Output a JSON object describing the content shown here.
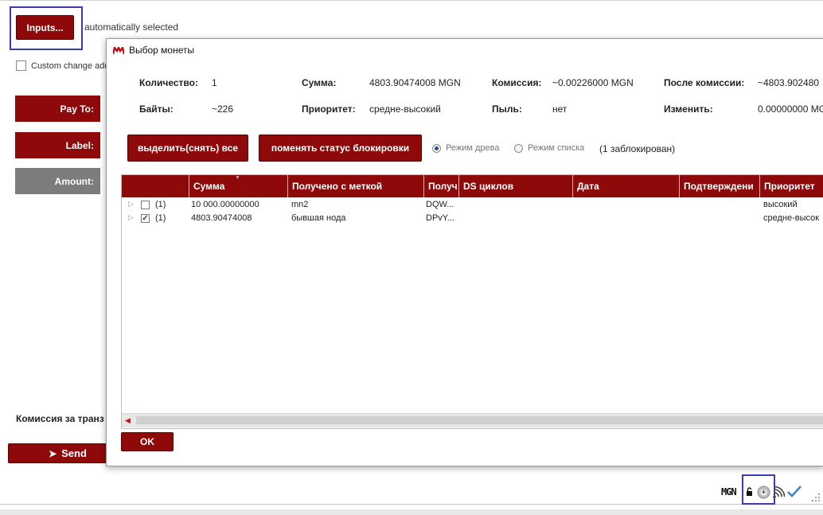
{
  "main": {
    "inputs_button": "Inputs...",
    "auto_selected": "automatically selected",
    "custom_change": "Custom change add",
    "pay_to_label": "Pay To:",
    "label_label": "Label:",
    "amount_label": "Amount:",
    "fee_label": "Комиссия за транз",
    "send_button": "Send"
  },
  "dialog": {
    "title": "Выбор монеты",
    "info": {
      "quantity_label": "Количество:",
      "quantity_value": "1",
      "sum_label": "Сумма:",
      "sum_value": "4803.90474008 MGN",
      "fee_label": "Комиссия:",
      "fee_value": "~0.00226000 MGN",
      "after_fee_label": "После комиссии:",
      "after_fee_value": "~4803.902480",
      "bytes_label": "Байты:",
      "bytes_value": "~226",
      "priority_label": "Приоритет:",
      "priority_value": "средне-высокий",
      "dust_label": "Пыль:",
      "dust_value": "нет",
      "change_label": "Изменить:",
      "change_value": "0.00000000 MG"
    },
    "select_all_button": "выделить(снять) все",
    "toggle_lock_button": "поменять статус блокировки",
    "tree_mode": "Режим древа",
    "list_mode": "Режим списка",
    "locked_count": "(1 заблокирован)",
    "columns": [
      "Сумма",
      "Получено с меткой",
      "Получ",
      "DS циклов",
      "Дата",
      "Подтверждени",
      "Приоритет"
    ],
    "rows": [
      {
        "count": "(1)",
        "checked": false,
        "amount": "10 000.00000000",
        "label": "mn2",
        "address": "DQW...",
        "priority": "высокий"
      },
      {
        "count": "(1)",
        "checked": true,
        "amount": "4803.90474008",
        "label": "бывшая нода",
        "address": "DPvY...",
        "priority": "средне-высок"
      }
    ],
    "ok_button": "OK"
  },
  "statusbar": {
    "unit": "MGN"
  },
  "colors": {
    "brand_red": "#8e0a0a",
    "highlight_blue": "#3b3bb7"
  }
}
